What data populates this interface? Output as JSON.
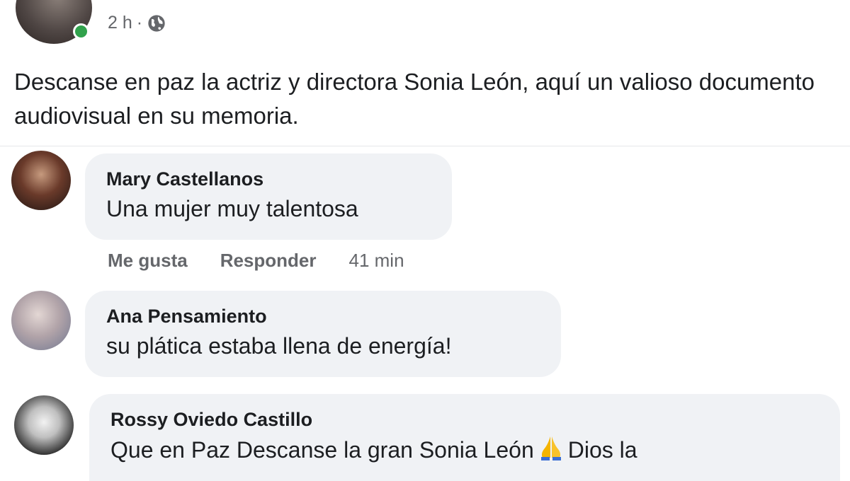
{
  "post": {
    "time": "2 h",
    "separator": "·",
    "privacy_icon": "globe-icon",
    "text": "Descanse en paz la actriz y directora Sonia León, aquí un valioso documento audiovisual en su memoria."
  },
  "comments": [
    {
      "author": "Mary Castellanos",
      "text": "Una mujer muy talentosa",
      "actions": {
        "like": "Me gusta",
        "reply": "Responder",
        "time": "41 min"
      }
    },
    {
      "author": "Ana Pensamiento",
      "text": "su plática estaba llena de energía!"
    },
    {
      "author": "Rossy Oviedo Castillo",
      "text_before": "Que en Paz Descanse la gran Sonia León",
      "emoji_icon": "praying-hands-icon",
      "text_after": "Dios la"
    }
  ],
  "colors": {
    "online": "#31a24c",
    "bubble": "#f0f2f5",
    "secondary_text": "#65676b",
    "primary_text": "#1c1e21"
  }
}
